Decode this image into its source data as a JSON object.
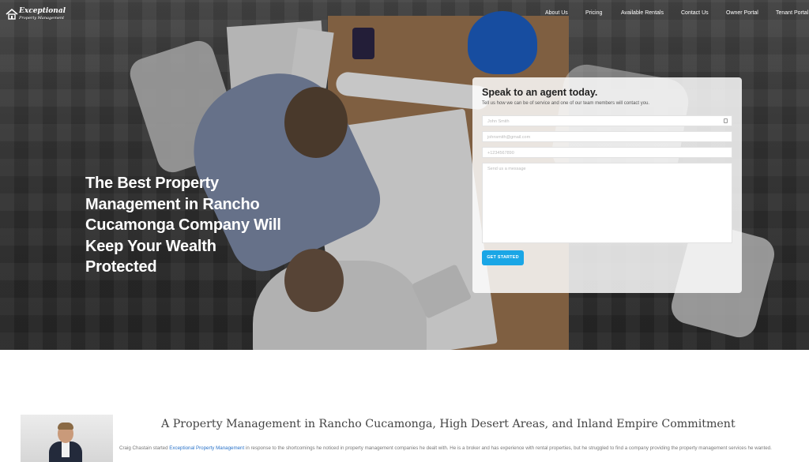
{
  "brand": {
    "logo_title": "Exceptional",
    "logo_subtitle": "Property Management"
  },
  "nav": {
    "items": [
      "About Us",
      "Pricing",
      "Available Rentals",
      "Contact Us",
      "Owner Portal",
      "Tenant Portal"
    ]
  },
  "hero": {
    "headline": "The Best Property Management in Rancho Cucamonga Company Will Keep Your Wealth Protected"
  },
  "form": {
    "title": "Speak to an agent today.",
    "subtitle": "Tell us how we can be of service and one of our team members will contact you.",
    "name_placeholder": "John Smith",
    "email_placeholder": "johnsmith@gmail.com",
    "phone_placeholder": "+1234567890",
    "message_placeholder": "Send us a message",
    "submit_label": "GET STARTED"
  },
  "section": {
    "title": "A Property Management in Rancho Cucamonga, High Desert Areas, and Inland Empire Commitment",
    "text_before_link": "Craig Chastain started ",
    "link_text": "Exceptional Property Management",
    "text_after_link": " in response to the shortcomings he noticed in property management companies he dealt with. He is a broker and has experience with rental properties, but he struggled to find a company providing the property management services he wanted."
  },
  "colors": {
    "accent": "#1aa6e6",
    "link": "#2a73c9"
  }
}
